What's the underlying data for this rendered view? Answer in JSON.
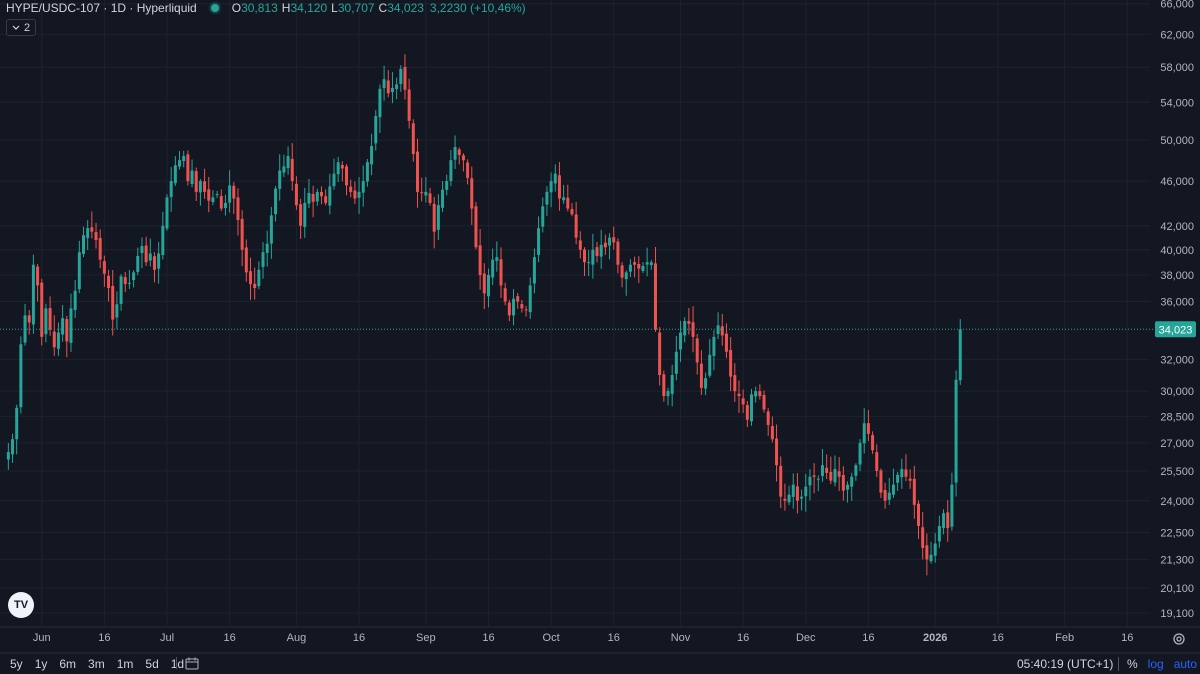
{
  "legend": {
    "symbol": "HYPE/USDC-107 · 1D · Hyperliquid",
    "o_label": "O",
    "o": "30,813",
    "h_label": "H",
    "h": "34,120",
    "l_label": "L",
    "l": "30,707",
    "c_label": "C",
    "c": "34,023",
    "change": "3,2230 (+10,46%)"
  },
  "indicators_badge": "2",
  "logo": "TV",
  "bottom": {
    "ranges": [
      "5y",
      "1y",
      "6m",
      "3m",
      "1m",
      "5d",
      "1d"
    ],
    "clock": "05:40:19 (UTC+1)",
    "pct": "%",
    "log": "log",
    "auto": "auto"
  },
  "colors": {
    "up": "#26a69a",
    "down": "#ef5350",
    "bg": "#131722",
    "grid": "#1e222d",
    "text": "#d1d4dc"
  },
  "chart_data": {
    "type": "candlestick",
    "scale": "log",
    "ylim": [
      18600,
      66500
    ],
    "y_ticks": [
      66000,
      62000,
      58000,
      54000,
      50000,
      46000,
      42000,
      40000,
      38000,
      36000,
      32000,
      30000,
      28500,
      27000,
      25500,
      24000,
      22500,
      21300,
      20100,
      19100
    ],
    "y_tick_labels": [
      "66,000",
      "62,000",
      "58,000",
      "54,000",
      "50,000",
      "46,000",
      "42,000",
      "40,000",
      "38,000",
      "36,000",
      "32,000",
      "30,000",
      "28,500",
      "27,000",
      "25,500",
      "24,000",
      "22,500",
      "21,300",
      "20,100",
      "19,100"
    ],
    "last_price": 34023,
    "last_price_label": "34,023",
    "x_labels": [
      {
        "label": "Jun",
        "day": 8,
        "bold": false
      },
      {
        "label": "16",
        "day": 23,
        "bold": false
      },
      {
        "label": "Jul",
        "day": 38,
        "bold": false
      },
      {
        "label": "16",
        "day": 53,
        "bold": false
      },
      {
        "label": "Aug",
        "day": 69,
        "bold": false
      },
      {
        "label": "16",
        "day": 84,
        "bold": false
      },
      {
        "label": "Sep",
        "day": 100,
        "bold": false
      },
      {
        "label": "16",
        "day": 115,
        "bold": false
      },
      {
        "label": "Oct",
        "day": 130,
        "bold": false
      },
      {
        "label": "16",
        "day": 145,
        "bold": false
      },
      {
        "label": "Nov",
        "day": 161,
        "bold": false
      },
      {
        "label": "16",
        "day": 176,
        "bold": false
      },
      {
        "label": "Dec",
        "day": 191,
        "bold": false
      },
      {
        "label": "16",
        "day": 206,
        "bold": false
      },
      {
        "label": "2026",
        "day": 222,
        "bold": true
      },
      {
        "label": "16",
        "day": 237,
        "bold": false
      },
      {
        "label": "Feb",
        "day": 253,
        "bold": false
      },
      {
        "label": "16",
        "day": 268,
        "bold": false
      }
    ],
    "close": [
      26500,
      27200,
      29000,
      33000,
      35000,
      34500,
      38800,
      37200,
      33500,
      35500,
      34000,
      32800,
      33800,
      34800,
      33200,
      35500,
      36800,
      39800,
      41200,
      41800,
      41500,
      40800,
      39200,
      38100,
      37000,
      34700,
      35800,
      37900,
      37300,
      37400,
      38200,
      39500,
      40300,
      39000,
      39700,
      38400,
      39700,
      42000,
      44500,
      46000,
      47500,
      48000,
      48400,
      46000,
      47000,
      45000,
      46000,
      45000,
      44200,
      44500,
      44800,
      43500,
      44000,
      45600,
      44400,
      42500,
      40000,
      38200,
      37300,
      37000,
      38400,
      39800,
      40500,
      42900,
      45300,
      47000,
      47400,
      48400,
      46000,
      43800,
      42000,
      44000,
      44900,
      44100,
      45000,
      44600,
      44000,
      45500,
      46700,
      47800,
      47200,
      45600,
      45000,
      44400,
      45000,
      46000,
      47800,
      49400,
      52500,
      55500,
      56600,
      55000,
      55600,
      56000,
      57800,
      55400,
      52000,
      48600,
      45000,
      44900,
      45000,
      44000,
      41500,
      43800,
      45200,
      46000,
      48000,
      49300,
      48500,
      48000,
      46300,
      43500,
      40200,
      38000,
      36600,
      38000,
      39200,
      39400,
      37200,
      36000,
      35000,
      36200,
      36000,
      35500,
      35400,
      37200,
      39400,
      41800,
      43700,
      45000,
      46000,
      46700,
      44400,
      44500,
      43500,
      43000,
      41000,
      40000,
      39000,
      39000,
      40000,
      39500,
      40400,
      40200,
      41000,
      40600,
      38800,
      37800,
      38200,
      38800,
      38800,
      38500,
      38700,
      39000,
      39000,
      34000,
      31000,
      29700,
      30000,
      31000,
      32500,
      33800,
      34600,
      34400,
      33500,
      31800,
      30200,
      30800,
      32300,
      33500,
      34300,
      33600,
      32500,
      30900,
      30000,
      29700,
      29200,
      28300,
      29800,
      30000,
      29700,
      28900,
      28000,
      27200,
      25800,
      24200,
      24000,
      24300,
      24800,
      24000,
      24200,
      24700,
      25200,
      25200,
      25100,
      25800,
      25400,
      25000,
      25600,
      25200,
      24500,
      24800,
      25200,
      25800,
      27000,
      28100,
      27500,
      26600,
      25500,
      24400,
      24000,
      24400,
      24800,
      25300,
      25600,
      25200,
      25000,
      23800,
      22800,
      21800,
      21300,
      21500,
      22000,
      22800,
      23400,
      22700,
      24800,
      30700,
      34023
    ]
  }
}
